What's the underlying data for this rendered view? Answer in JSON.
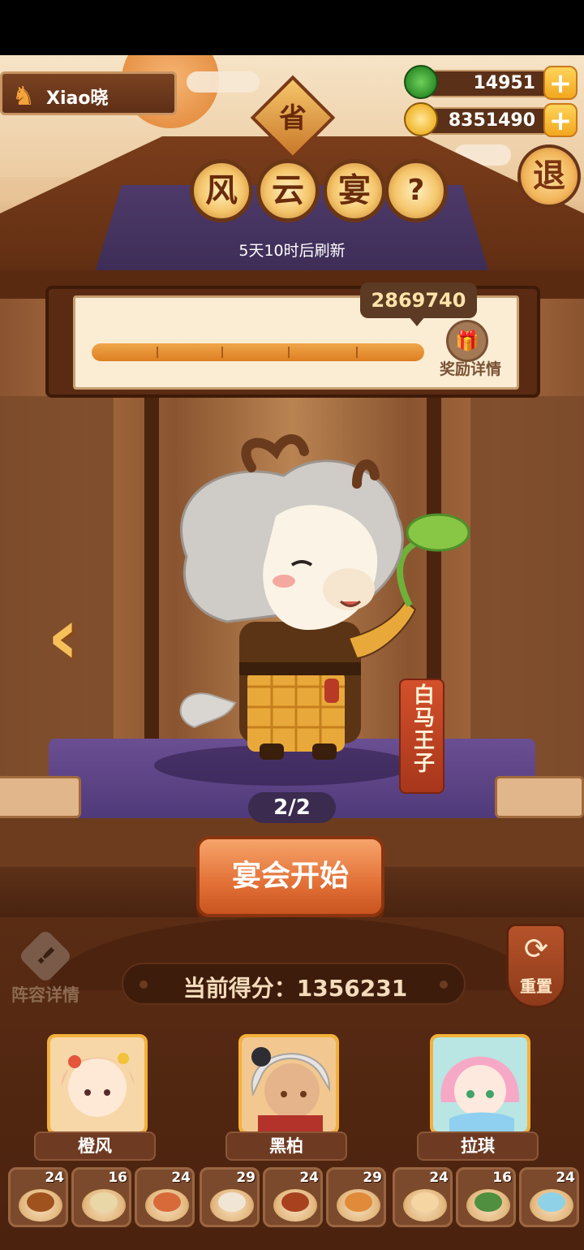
{
  "player": {
    "name": "Xiao晓"
  },
  "currency": [
    {
      "icon": "jade-coin-icon",
      "value": "14951",
      "color": "#3fa23a"
    },
    {
      "icon": "gold-coin-icon",
      "value": "8351490",
      "color": "#f0b52c"
    }
  ],
  "header": {
    "badge": "省",
    "exit_label": "退",
    "title_chars": [
      "风",
      "云",
      "宴"
    ],
    "help_label": "?",
    "refresh_text": "5天10时后刷新"
  },
  "progress": {
    "goal": "2869740",
    "fraction": 1.0,
    "reward_icon": "gift-icon",
    "reward_label": "奖励详情"
  },
  "character": {
    "name": "白马王子",
    "page": "2/2"
  },
  "start_button": "宴会开始",
  "lineup_label": "阵容详情",
  "reset_label": "重置",
  "score": {
    "text": "当前得分：1356231"
  },
  "heroes": [
    {
      "name": "橙风",
      "bg": "#f7d7a8"
    },
    {
      "name": "黑柏",
      "bg": "#f2c890"
    },
    {
      "name": "拉琪",
      "bg": "#b9e6e2"
    }
  ],
  "dishes": [
    {
      "count": "24",
      "color": "#a0521e"
    },
    {
      "count": "16",
      "color": "#e9d7a8"
    },
    {
      "count": "24",
      "color": "#d86a3a"
    },
    {
      "count": "29",
      "color": "#f1e6d6"
    },
    {
      "count": "24",
      "color": "#a8421e"
    },
    {
      "count": "29",
      "color": "#e08a3a"
    },
    {
      "count": "24",
      "color": "#f5d6a2"
    },
    {
      "count": "16",
      "color": "#4f8f3f"
    },
    {
      "count": "24",
      "color": "#8fd1e6"
    }
  ]
}
